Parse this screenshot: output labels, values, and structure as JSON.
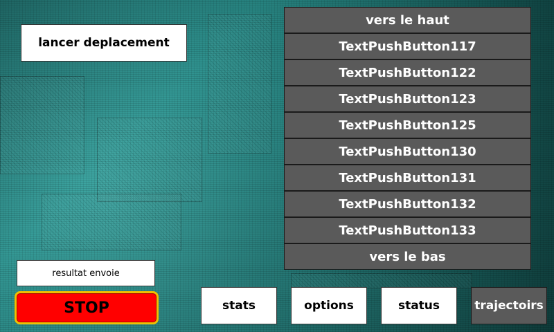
{
  "launch_button": {
    "label": "lancer deplacement"
  },
  "list": {
    "up_label": "vers le haut",
    "items": [
      "TextPushButton117",
      "TextPushButton122",
      "TextPushButton123",
      "TextPushButton125",
      "TextPushButton130",
      "TextPushButton131",
      "TextPushButton132",
      "TextPushButton133"
    ],
    "down_label": "vers le bas"
  },
  "result_field": {
    "value": "resultat envoie"
  },
  "stop_button": {
    "label": "STOP",
    "color": "#ff0000",
    "border_color": "#f0c000"
  },
  "bottom_nav": {
    "stats": "stats",
    "options": "options",
    "status": "status",
    "trajectoirs": "trajectoirs"
  },
  "colors": {
    "background": "#2a8a87",
    "list_button": "#5a5a5a",
    "white_button": "#ffffff"
  }
}
